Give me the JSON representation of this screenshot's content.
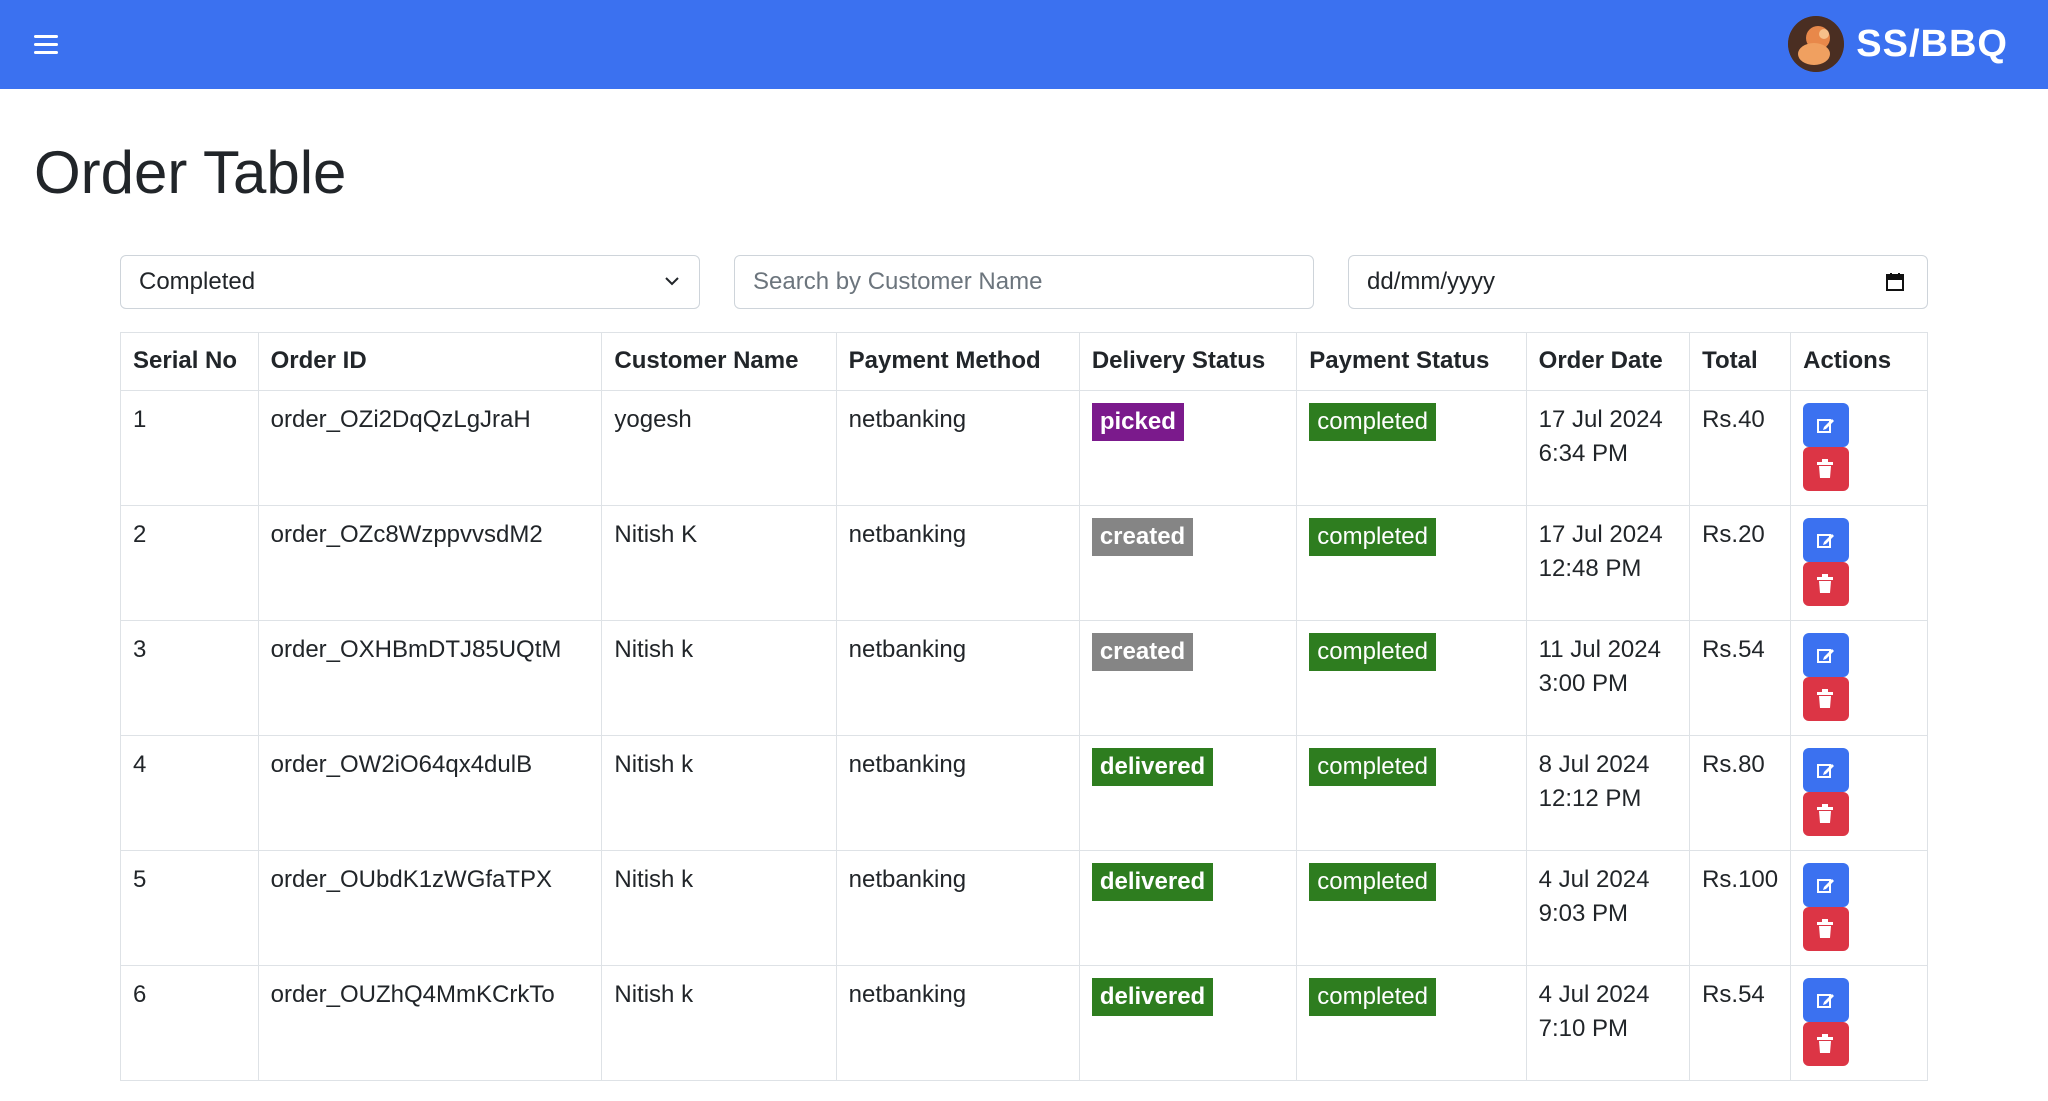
{
  "brand": {
    "name": "SS/BBQ"
  },
  "page": {
    "title": "Order Table"
  },
  "filters": {
    "status_value": "Completed",
    "search_placeholder": "Search by Customer Name",
    "date_placeholder": "dd/mm/yyyy"
  },
  "table": {
    "headers": [
      "Serial No",
      "Order ID",
      "Customer Name",
      "Payment Method",
      "Delivery Status",
      "Payment Status",
      "Order Date",
      "Total",
      "Actions"
    ],
    "rows": [
      {
        "serial": "1",
        "order_id": "order_OZi2DqQzLgJraH",
        "customer": "yogesh",
        "payment_method": "netbanking",
        "delivery_status": "picked",
        "delivery_color": "#7b1a8c",
        "payment_status": "completed",
        "date": "17 Jul 2024",
        "time": "6:34 PM",
        "total": "Rs.40"
      },
      {
        "serial": "2",
        "order_id": "order_OZc8WzppvvsdM2",
        "customer": "Nitish K",
        "payment_method": "netbanking",
        "delivery_status": "created",
        "delivery_color": "#858585",
        "payment_status": "completed",
        "date": "17 Jul 2024",
        "time": "12:48 PM",
        "total": "Rs.20"
      },
      {
        "serial": "3",
        "order_id": "order_OXHBmDTJ85UQtM",
        "customer": "Nitish k",
        "payment_method": "netbanking",
        "delivery_status": "created",
        "delivery_color": "#858585",
        "payment_status": "completed",
        "date": "11 Jul 2024",
        "time": "3:00 PM",
        "total": "Rs.54"
      },
      {
        "serial": "4",
        "order_id": "order_OW2iO64qx4dulB",
        "customer": "Nitish k",
        "payment_method": "netbanking",
        "delivery_status": "delivered",
        "delivery_color": "#2e7d1f",
        "payment_status": "completed",
        "date": "8 Jul 2024",
        "time": "12:12 PM",
        "total": "Rs.80"
      },
      {
        "serial": "5",
        "order_id": "order_OUbdK1zWGfaTPX",
        "customer": "Nitish k",
        "payment_method": "netbanking",
        "delivery_status": "delivered",
        "delivery_color": "#2e7d1f",
        "payment_status": "completed",
        "date": "4 Jul 2024",
        "time": "9:03 PM",
        "total": "Rs.100"
      },
      {
        "serial": "6",
        "order_id": "order_OUZhQ4MmKCrkTo",
        "customer": "Nitish k",
        "payment_method": "netbanking",
        "delivery_status": "delivered",
        "delivery_color": "#2e7d1f",
        "payment_status": "completed",
        "date": "4 Jul 2024",
        "time": "7:10 PM",
        "total": "Rs.54"
      }
    ]
  },
  "colors": {
    "navbar": "#3b71f0",
    "payment_completed": "#2e7d1f",
    "edit_button": "#3b71f0",
    "delete_button": "#dc3545"
  },
  "icons": [
    "menu-icon",
    "brand-logo",
    "chevron-down-icon",
    "calendar-icon",
    "edit-icon",
    "trash-icon"
  ]
}
